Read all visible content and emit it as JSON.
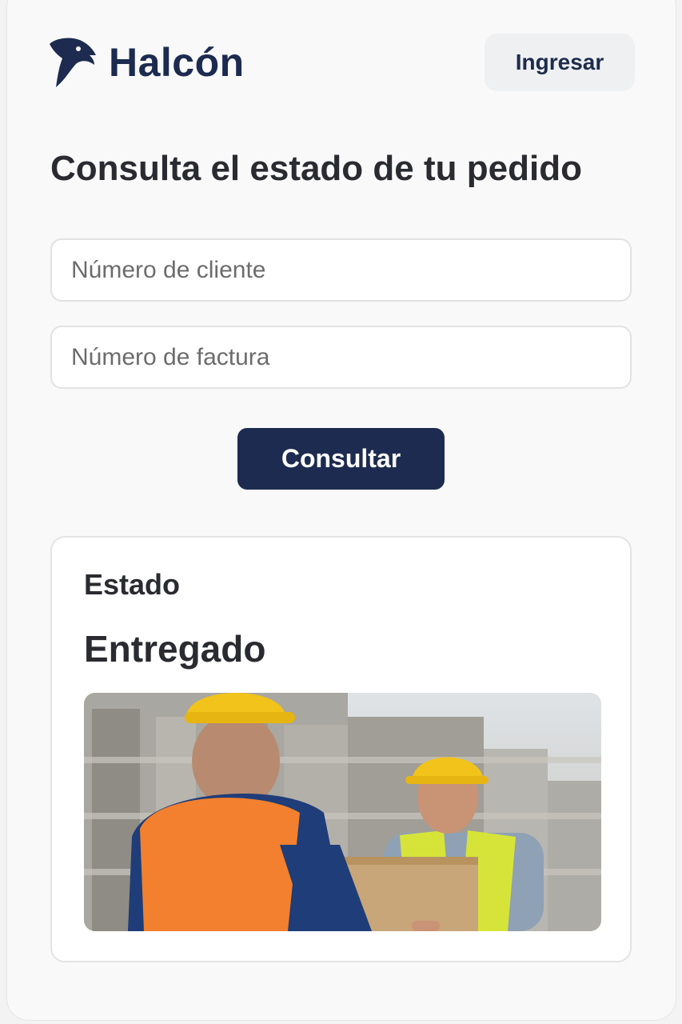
{
  "brand": {
    "name": "Halcón",
    "logo_icon": "falcon-head-icon",
    "color": "#1c2b4f"
  },
  "header": {
    "login_label": "Ingresar"
  },
  "form": {
    "title": "Consulta el estado de tu pedido",
    "client_placeholder": "Número de cliente",
    "invoice_placeholder": "Número de factura",
    "submit_label": "Consultar"
  },
  "result": {
    "label": "Estado",
    "value": "Entregado",
    "photo": "delivery-workers-photo"
  },
  "colors": {
    "accent": "#1c2b4f",
    "background": "#f9f9f9"
  }
}
